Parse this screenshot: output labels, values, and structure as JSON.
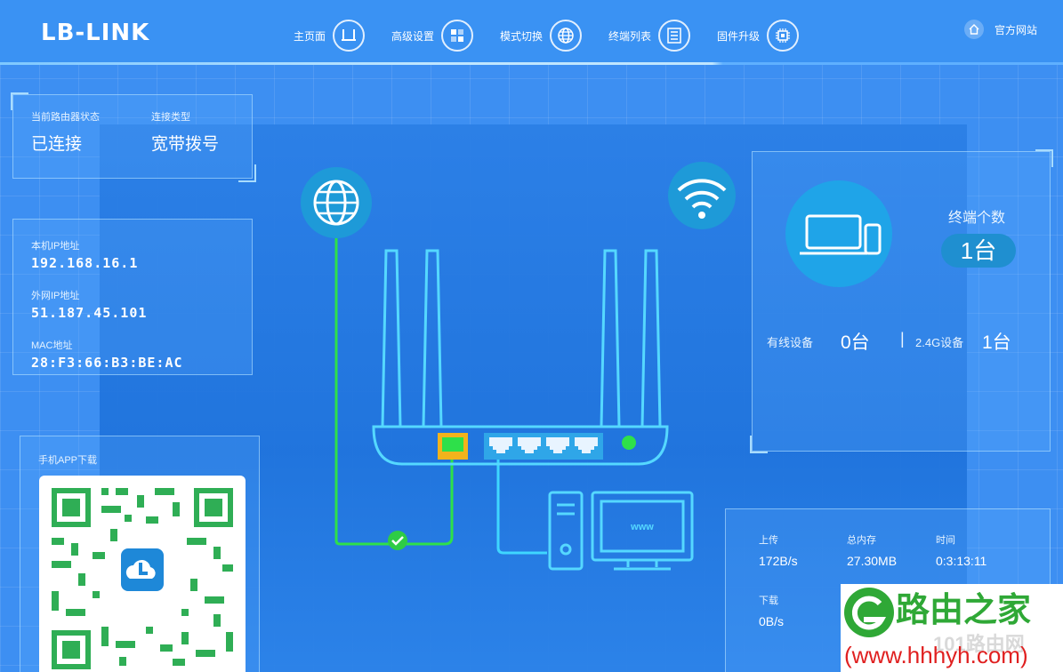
{
  "header": {
    "logo": "LB-LINK",
    "nav": [
      {
        "label": "主页面",
        "icon": "router-icon"
      },
      {
        "label": "高级设置",
        "icon": "grid-settings-icon"
      },
      {
        "label": "模式切换",
        "icon": "globe-icon"
      },
      {
        "label": "终端列表",
        "icon": "list-icon"
      },
      {
        "label": "固件升级",
        "icon": "chip-icon"
      }
    ],
    "official_site": "官方网站"
  },
  "status": {
    "router_state_label": "当前路由器状态",
    "router_state_value": "已连接",
    "conn_type_label": "连接类型",
    "conn_type_value": "宽带拨号"
  },
  "network": {
    "local_ip_label": "本机IP地址",
    "local_ip": "192.168.16.1",
    "wan_ip_label": "外网IP地址",
    "wan_ip": "51.187.45.101",
    "mac_label": "MAC地址",
    "mac": "28:F3:66:B3:BE:AC"
  },
  "app": {
    "download_label": "手机APP下载"
  },
  "diagram": {
    "screen_text": "www"
  },
  "terminals": {
    "count_label": "终端个数",
    "count_value": "1台",
    "wired_label": "有线设备",
    "wired_value": "0台",
    "wifi24_label": "2.4G设备",
    "wifi24_value": "1台",
    "separator": "|"
  },
  "stats": {
    "upload_label": "上传",
    "upload_value": "172B/s",
    "memory_label": "总内存",
    "memory_value": "27.30MB",
    "time_label": "时间",
    "time_value": "0:3:13:11",
    "download_label": "下载",
    "download_value": "0B/s"
  },
  "watermark": {
    "brand": "路由之家",
    "url": "(www.hhhyh.com)",
    "faint": "101路由网"
  },
  "colors": {
    "background": "#3d8ff2",
    "line_green": "#2ee04a",
    "line_cyan": "#3fd6ff",
    "port_yellow": "#f2b31c",
    "badge_bg": "#1f8fd0",
    "wm_green": "#2fa836",
    "wm_red": "#e02020"
  }
}
